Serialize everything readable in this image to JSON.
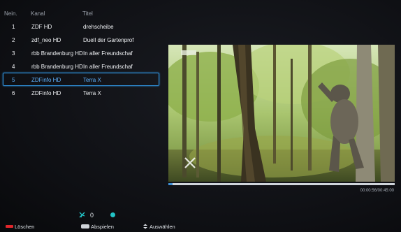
{
  "list": {
    "headers": {
      "num": "Nein.",
      "channel": "Kanal",
      "title": "Titel"
    },
    "rows": [
      {
        "num": "1",
        "channel": "ZDF HD",
        "title": "drehscheibe"
      },
      {
        "num": "2",
        "channel": "zdf_neo HD",
        "title": "Duell der Gartenprof"
      },
      {
        "num": "3",
        "channel": "rbb Brandenburg HD",
        "title": "In aller Freundschaf"
      },
      {
        "num": "4",
        "channel": "rbb Brandenburg HD",
        "title": "In aller Freundschaf"
      },
      {
        "num": "5",
        "channel": "ZDFinfo HD",
        "title": "Terra X"
      },
      {
        "num": "6",
        "channel": "ZDFinfo HD",
        "title": "Terra X"
      }
    ],
    "selected_index": 4
  },
  "player": {
    "progress_fraction": 0.02,
    "timecode": "00:00:56/00:45:00"
  },
  "status": {
    "count": "0",
    "icon": "no-signal-icon"
  },
  "bottom": {
    "delete_label": "Löschen",
    "play_label": "Abspielen",
    "select_label": "Auswählen"
  },
  "colors": {
    "selection": "#2f8fd8",
    "delete_key": "#e0262b",
    "status_dot": "#22c3c6",
    "progress": "#3e8fd6"
  }
}
